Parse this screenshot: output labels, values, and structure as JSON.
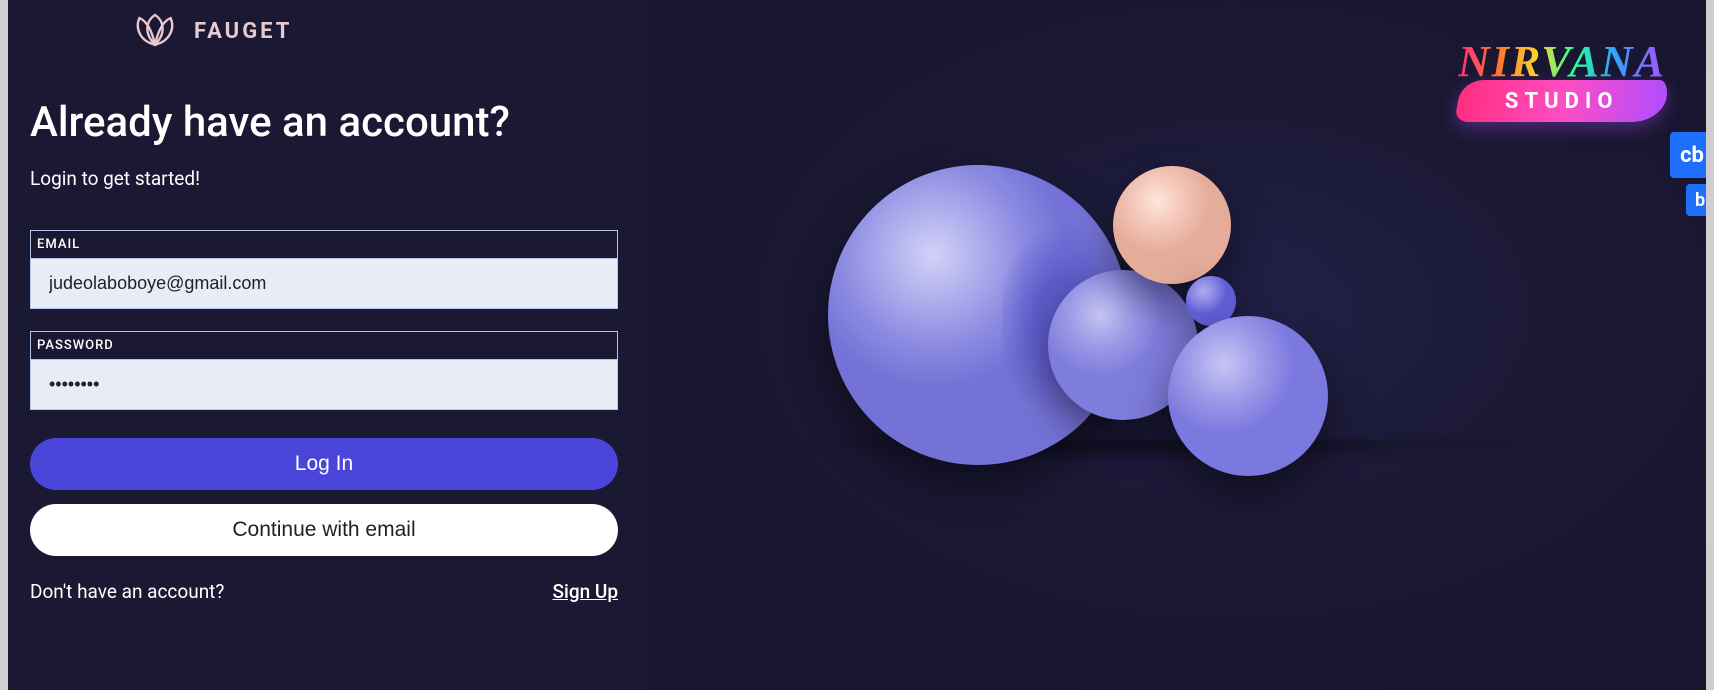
{
  "brand": {
    "name": "FAUGET"
  },
  "heading": "Already have an account?",
  "subheading": "Login to  get started!",
  "fields": {
    "email": {
      "label": "EMAIL",
      "value": "judeolaboboye@gmail.com"
    },
    "password": {
      "label": "PASSWORD",
      "value": "••••••••"
    }
  },
  "buttons": {
    "login": "Log In",
    "continue_email": "Continue with email"
  },
  "signup": {
    "prompt": "Don't have an account?",
    "link": "Sign Up"
  },
  "watermark": {
    "line1": "NIRVANA",
    "line2": "STUDIO"
  },
  "side_tabs": {
    "primary": "cb",
    "secondary": "b"
  }
}
